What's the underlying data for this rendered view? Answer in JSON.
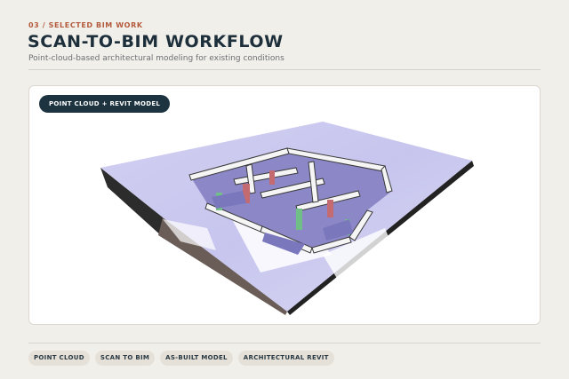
{
  "header": {
    "eyebrow": "03 / SELECTED BIM WORK",
    "title": "SCAN-TO-BIM WORKFLOW",
    "subtitle": "Point-cloud-based architectural modeling for existing conditions"
  },
  "figure": {
    "badge": "POINT CLOUD + REVIT MODEL"
  },
  "tags": [
    "POINT CLOUD",
    "SCAN TO BIM",
    "AS-BUILT MODEL",
    "ARCHITECTURAL REVIT"
  ],
  "colors": {
    "accent": "#b35a3c",
    "navy": "#1d3440",
    "background": "#f1efea",
    "tag_bg": "#e6e1d8"
  }
}
